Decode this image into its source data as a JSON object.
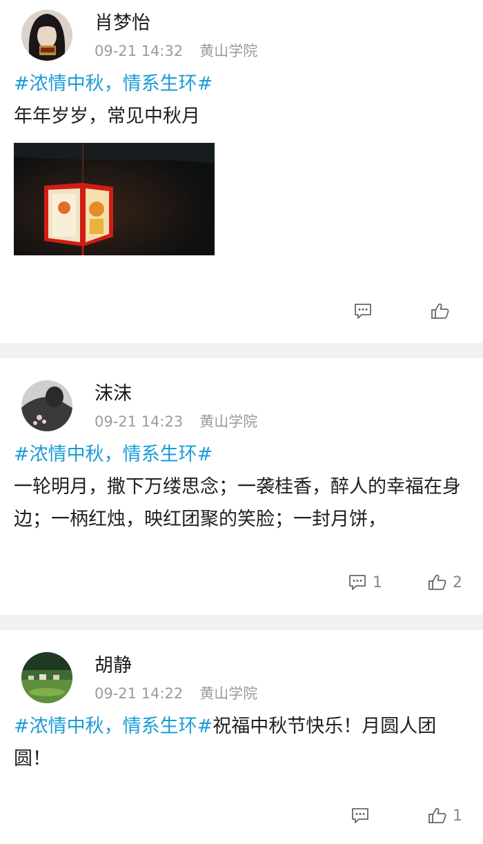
{
  "colors": {
    "tag": "#1a9bd7",
    "meta": "#9a9a9a",
    "separator": "#f1f1f1",
    "icon": "#666666"
  },
  "posts": [
    {
      "author": "肖梦怡",
      "time": "09-21 14:32",
      "location": "黄山学院",
      "hashtag": "#浓情中秋，情系生环#",
      "text": "年年岁岁，常见中秋月",
      "has_image": true,
      "image_desc_icon": "lantern-photo",
      "comment_count": "",
      "like_count": ""
    },
    {
      "author": "沫沫",
      "time": "09-21 14:23",
      "location": "黄山学院",
      "hashtag": "#浓情中秋，情系生环#",
      "text": "一轮明月，撒下万缕思念；一袭桂香，醉人的幸福在身边；一柄红烛，映红团聚的笑脸；一封月饼，",
      "has_image": false,
      "comment_count": "1",
      "like_count": "2"
    },
    {
      "author": "胡静",
      "time": "09-21 14:22",
      "location": "黄山学院",
      "hashtag": "#浓情中秋，情系生环#",
      "text": "祝福中秋节快乐！月圆人团圆！",
      "has_image": false,
      "comment_count": "",
      "like_count": "1"
    }
  ],
  "icons": {
    "comment": "comment-icon",
    "like": "thumbs-up-icon"
  }
}
